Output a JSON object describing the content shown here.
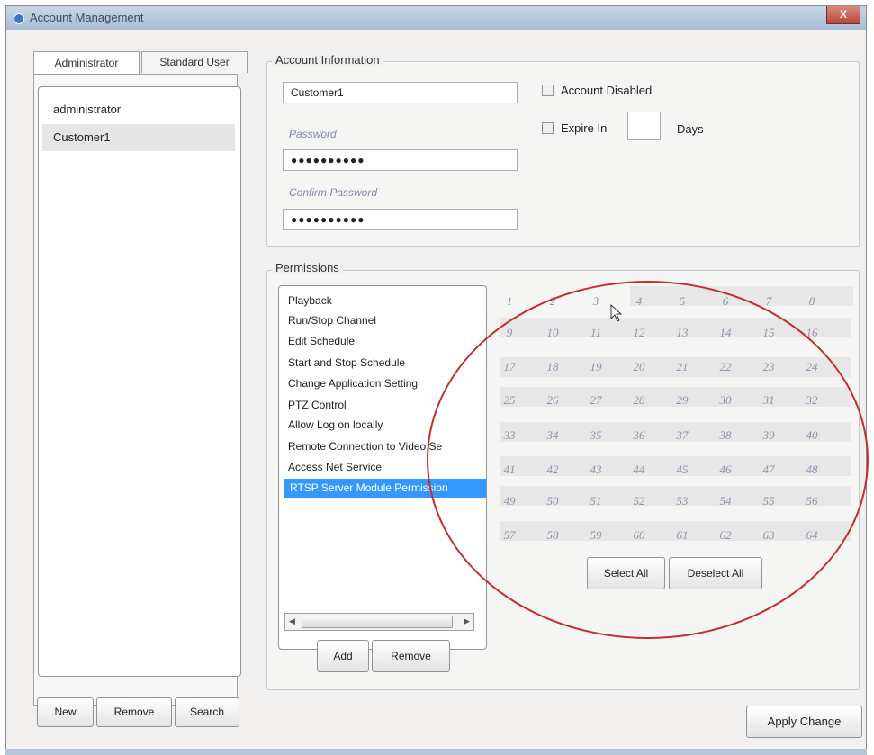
{
  "window": {
    "title": "Account Management",
    "close_label": "X"
  },
  "tabs": [
    {
      "label": "Administrator",
      "active": true
    },
    {
      "label": "Standard User",
      "active": false
    }
  ],
  "users": [
    {
      "label": "administrator",
      "selected": false
    },
    {
      "label": "Customer1",
      "selected": true
    }
  ],
  "user_buttons": {
    "new": "New",
    "remove": "Remove",
    "search": "Search"
  },
  "account_info": {
    "title": "Account Information",
    "username": "Customer1",
    "password_label": "Password",
    "password_value": "●●●●●●●●●●",
    "confirm_label": "Confirm Password",
    "confirm_value": "●●●●●●●●●●",
    "account_disabled": "Account Disabled",
    "expire_in": "Expire In",
    "days": "Days",
    "expire_value": ""
  },
  "permissions": {
    "title": "Permissions",
    "items": [
      {
        "label": "Playback",
        "selected": false
      },
      {
        "label": "Run/Stop Channel",
        "selected": false
      },
      {
        "label": "Edit Schedule",
        "selected": false
      },
      {
        "label": "Start and Stop Schedule",
        "selected": false
      },
      {
        "label": "Change Application Setting",
        "selected": false
      },
      {
        "label": "PTZ Control",
        "selected": false
      },
      {
        "label": "Allow Log on locally",
        "selected": false
      },
      {
        "label": "Remote Connection to Video Se",
        "selected": false
      },
      {
        "label": "Access Net Service",
        "selected": false
      },
      {
        "label": "RTSP Server Module Permission",
        "selected": true
      }
    ],
    "add": "Add",
    "remove": "Remove"
  },
  "channels": [
    "1",
    "2",
    "3",
    "4",
    "5",
    "6",
    "7",
    "8",
    "9",
    "10",
    "11",
    "12",
    "13",
    "14",
    "15",
    "16",
    "17",
    "18",
    "19",
    "20",
    "21",
    "22",
    "23",
    "24",
    "25",
    "26",
    "27",
    "28",
    "29",
    "30",
    "31",
    "32",
    "33",
    "34",
    "35",
    "36",
    "37",
    "38",
    "39",
    "40",
    "41",
    "42",
    "43",
    "44",
    "45",
    "46",
    "47",
    "48",
    "49",
    "50",
    "51",
    "52",
    "53",
    "54",
    "55",
    "56",
    "57",
    "58",
    "59",
    "60",
    "61",
    "62",
    "63",
    "64"
  ],
  "channel_buttons": {
    "select_all": "Select All",
    "deselect_all": "Deselect All"
  },
  "apply_change": "Apply Change",
  "colors": {
    "selection": "#3399ff",
    "annotation_ring": "#c0302e",
    "channel_text": "#8e95ad"
  }
}
